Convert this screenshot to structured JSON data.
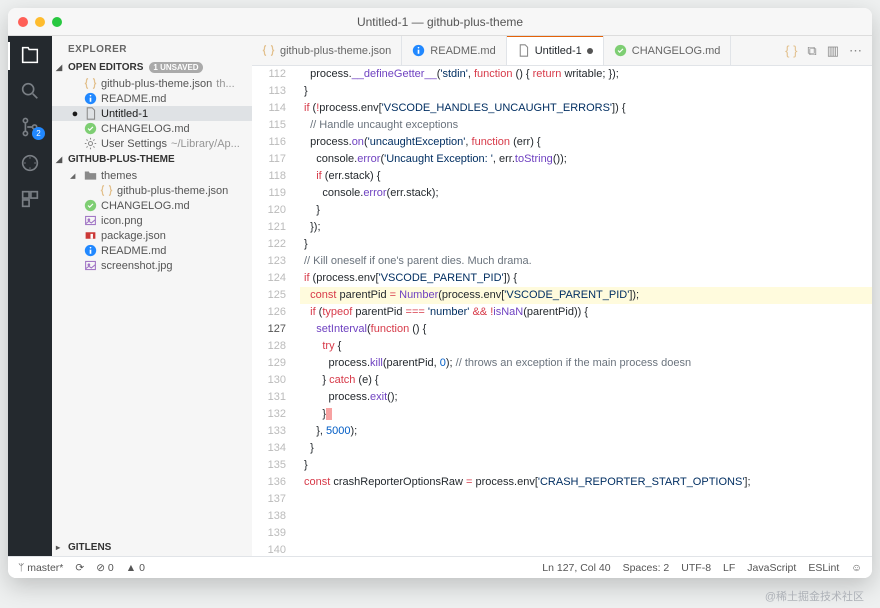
{
  "title": "Untitled-1 — github-plus-theme",
  "activity": {
    "scm_badge": "2"
  },
  "sidebar": {
    "title": "EXPLORER",
    "openEditors": {
      "label": "OPEN EDITORS",
      "unsaved": "1 UNSAVED",
      "items": [
        {
          "name": "github-plus-theme.json",
          "hint": " th...",
          "icon": "json"
        },
        {
          "name": "README.md",
          "icon": "info"
        },
        {
          "name": "Untitled-1",
          "icon": "file",
          "sel": true,
          "dirty": true
        },
        {
          "name": "CHANGELOG.md",
          "icon": "todo"
        },
        {
          "name": "User Settings",
          "hint": " ~/Library/Ap...",
          "icon": "gear"
        }
      ]
    },
    "project": {
      "label": "GITHUB-PLUS-THEME",
      "items": [
        {
          "name": "themes",
          "icon": "folder",
          "expanded": true,
          "indent": 0
        },
        {
          "name": "github-plus-theme.json",
          "icon": "json",
          "indent": 1
        },
        {
          "name": "CHANGELOG.md",
          "icon": "todo",
          "indent": 0
        },
        {
          "name": "icon.png",
          "icon": "img",
          "indent": 0
        },
        {
          "name": "package.json",
          "icon": "npm",
          "indent": 0
        },
        {
          "name": "README.md",
          "icon": "info",
          "indent": 0
        },
        {
          "name": "screenshot.jpg",
          "icon": "img",
          "indent": 0
        }
      ]
    },
    "gitlens": "GITLENS"
  },
  "tabs": [
    {
      "label": "github-plus-theme.json",
      "icon": "json"
    },
    {
      "label": "README.md",
      "icon": "info"
    },
    {
      "label": "Untitled-1",
      "icon": "file",
      "active": true,
      "dirty": true
    },
    {
      "label": "CHANGELOG.md",
      "icon": "todo"
    }
  ],
  "code": {
    "start": 112,
    "highlight": 127,
    "lines": [
      [
        [
          "  process.",
          "var"
        ],
        [
          "__defineGetter__",
          "fn"
        ],
        [
          "(",
          "var"
        ],
        [
          "'stdin'",
          "str"
        ],
        [
          ", ",
          "var"
        ],
        [
          "function",
          "kw"
        ],
        [
          " () { ",
          "var"
        ],
        [
          "return",
          "kw"
        ],
        [
          " writable; });",
          "var"
        ]
      ],
      [
        [
          "}",
          "var"
        ]
      ],
      [
        [
          "",
          null
        ]
      ],
      [
        [
          "if",
          "kw"
        ],
        [
          " (",
          "var"
        ],
        [
          "!",
          "op"
        ],
        [
          "process.env[",
          "var"
        ],
        [
          "'VSCODE_HANDLES_UNCAUGHT_ERRORS'",
          "str"
        ],
        [
          "]) {",
          "var"
        ]
      ],
      [
        [
          "  ",
          "var"
        ],
        [
          "// Handle uncaught exceptions",
          "cm"
        ]
      ],
      [
        [
          "  process.",
          "var"
        ],
        [
          "on",
          "fn"
        ],
        [
          "(",
          "var"
        ],
        [
          "'uncaughtException'",
          "str"
        ],
        [
          ", ",
          "var"
        ],
        [
          "function",
          "kw"
        ],
        [
          " (err) {",
          "var"
        ]
      ],
      [
        [
          "    console.",
          "var"
        ],
        [
          "error",
          "fn"
        ],
        [
          "(",
          "var"
        ],
        [
          "'Uncaught Exception: '",
          "str"
        ],
        [
          ", err.",
          "var"
        ],
        [
          "toString",
          "fn"
        ],
        [
          "());",
          "var"
        ]
      ],
      [
        [
          "    ",
          "var"
        ],
        [
          "if",
          "kw"
        ],
        [
          " (err.stack) {",
          "var"
        ]
      ],
      [
        [
          "      console.",
          "var"
        ],
        [
          "error",
          "fn"
        ],
        [
          "(err.stack);",
          "var"
        ]
      ],
      [
        [
          "    }",
          "var"
        ]
      ],
      [
        [
          "  });",
          "var"
        ]
      ],
      [
        [
          "}",
          "var"
        ]
      ],
      [
        [
          "",
          null
        ]
      ],
      [
        [
          "",
          "var"
        ],
        [
          "// Kill oneself if one's parent dies. Much drama.",
          "cm"
        ]
      ],
      [
        [
          "",
          "var"
        ],
        [
          "if",
          "kw"
        ],
        [
          " (process.env[",
          "var"
        ],
        [
          "'VSCODE_PARENT_PID'",
          "str"
        ],
        [
          "]) {",
          "var"
        ]
      ],
      [
        [
          "  ",
          "var"
        ],
        [
          "const",
          "kw"
        ],
        [
          " parentPid ",
          "var"
        ],
        [
          "=",
          "op"
        ],
        [
          " ",
          "var"
        ],
        [
          "Number",
          "fn"
        ],
        [
          "(process.env[",
          "var"
        ],
        [
          "'VSCODE_PARENT_PID'",
          "str"
        ],
        [
          "]);",
          "var"
        ]
      ],
      [
        [
          "",
          null
        ]
      ],
      [
        [
          "  ",
          "var"
        ],
        [
          "if",
          "kw"
        ],
        [
          " (",
          "var"
        ],
        [
          "typeof",
          "kw"
        ],
        [
          " parentPid ",
          "var"
        ],
        [
          "===",
          "op"
        ],
        [
          " ",
          "var"
        ],
        [
          "'number'",
          "str"
        ],
        [
          " ",
          "var"
        ],
        [
          "&&",
          "op"
        ],
        [
          " ",
          "var"
        ],
        [
          "!",
          "op"
        ],
        [
          "isNaN",
          "fn"
        ],
        [
          "(parentPid)) {",
          "var"
        ]
      ],
      [
        [
          "    ",
          "var"
        ],
        [
          "setInterval",
          "fn"
        ],
        [
          "(",
          "var"
        ],
        [
          "function",
          "kw"
        ],
        [
          " () {",
          "var"
        ]
      ],
      [
        [
          "      ",
          "var"
        ],
        [
          "try",
          "kw"
        ],
        [
          " {",
          "var"
        ]
      ],
      [
        [
          "        process.",
          "var"
        ],
        [
          "kill",
          "fn"
        ],
        [
          "(parentPid, ",
          "var"
        ],
        [
          "0",
          "num"
        ],
        [
          "); ",
          "var"
        ],
        [
          "// throws an exception if the main process doesn",
          "cm"
        ]
      ],
      [
        [
          "      } ",
          "var"
        ],
        [
          "catch",
          "kw"
        ],
        [
          " (e) {",
          "var"
        ]
      ],
      [
        [
          "        process.",
          "var"
        ],
        [
          "exit",
          "fn"
        ],
        [
          "();",
          "var"
        ]
      ],
      [
        [
          "      }",
          "var"
        ],
        [
          "  ",
          "cursor-sel"
        ]
      ],
      [
        [
          "    }, ",
          "var"
        ],
        [
          "5000",
          "num"
        ],
        [
          ");",
          "var"
        ]
      ],
      [
        [
          "  }",
          "var"
        ]
      ],
      [
        [
          "}",
          "var"
        ]
      ],
      [
        [
          "",
          null
        ]
      ],
      [
        [
          "",
          "var"
        ],
        [
          "const",
          "kw"
        ],
        [
          " crashReporterOptionsRaw ",
          "var"
        ],
        [
          "=",
          "op"
        ],
        [
          " process.env[",
          "var"
        ],
        [
          "'CRASH_REPORTER_START_OPTIONS'",
          "str"
        ],
        [
          "];",
          "var"
        ]
      ]
    ]
  },
  "status": {
    "branch": "master*",
    "sync": "⟳",
    "errors": "⊘ 0",
    "warnings": "▲ 0",
    "pos": "Ln 127, Col 40",
    "spaces": "Spaces: 2",
    "enc": "UTF-8",
    "eol": "LF",
    "lang": "JavaScript",
    "eslint": "ESLint",
    "smile": "☺"
  },
  "watermark": "@稀土掘金技术社区"
}
